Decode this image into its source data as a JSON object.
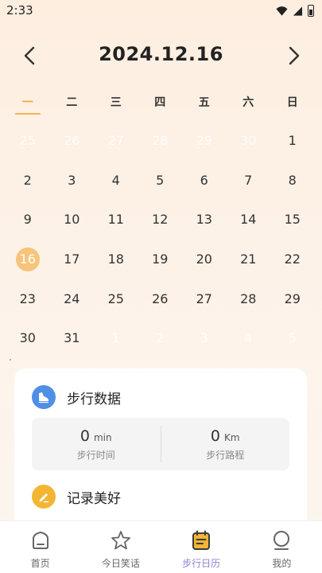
{
  "status_bar": {
    "time": "2:33"
  },
  "header": {
    "title": "2024.12.16"
  },
  "weekdays": [
    "一",
    "二",
    "三",
    "四",
    "五",
    "六",
    "日"
  ],
  "calendar": {
    "weeks": [
      [
        "25",
        "26",
        "27",
        "28",
        "29",
        "30",
        "1"
      ],
      [
        "2",
        "3",
        "4",
        "5",
        "6",
        "7",
        "8"
      ],
      [
        "9",
        "10",
        "11",
        "12",
        "13",
        "14",
        "15"
      ],
      [
        "16",
        "17",
        "18",
        "19",
        "20",
        "21",
        "22"
      ],
      [
        "23",
        "24",
        "25",
        "26",
        "27",
        "28",
        "29"
      ],
      [
        "30",
        "31",
        "1",
        "2",
        "3",
        "4",
        "5"
      ]
    ],
    "selected": "16"
  },
  "steps_card": {
    "title": "步行数据",
    "time_value": "0",
    "time_unit": "min",
    "time_label": "步行时间",
    "distance_value": "0",
    "distance_unit": "Km",
    "distance_label": "步行路程"
  },
  "record_card": {
    "title": "记录美好"
  },
  "bottom_nav": {
    "items": [
      {
        "label": "首页",
        "icon": "home-icon"
      },
      {
        "label": "今日笑话",
        "icon": "star-icon"
      },
      {
        "label": "步行日历",
        "icon": "calendar-icon"
      },
      {
        "label": "我的",
        "icon": "profile-icon"
      }
    ],
    "active": "步行日历"
  },
  "colors": {
    "accent": "#f0a93b",
    "selected_day": "#f6c47a",
    "nav_active": "#8f7fd6",
    "steps_icon": "#4f8fe6",
    "record_icon": "#f2b632"
  }
}
